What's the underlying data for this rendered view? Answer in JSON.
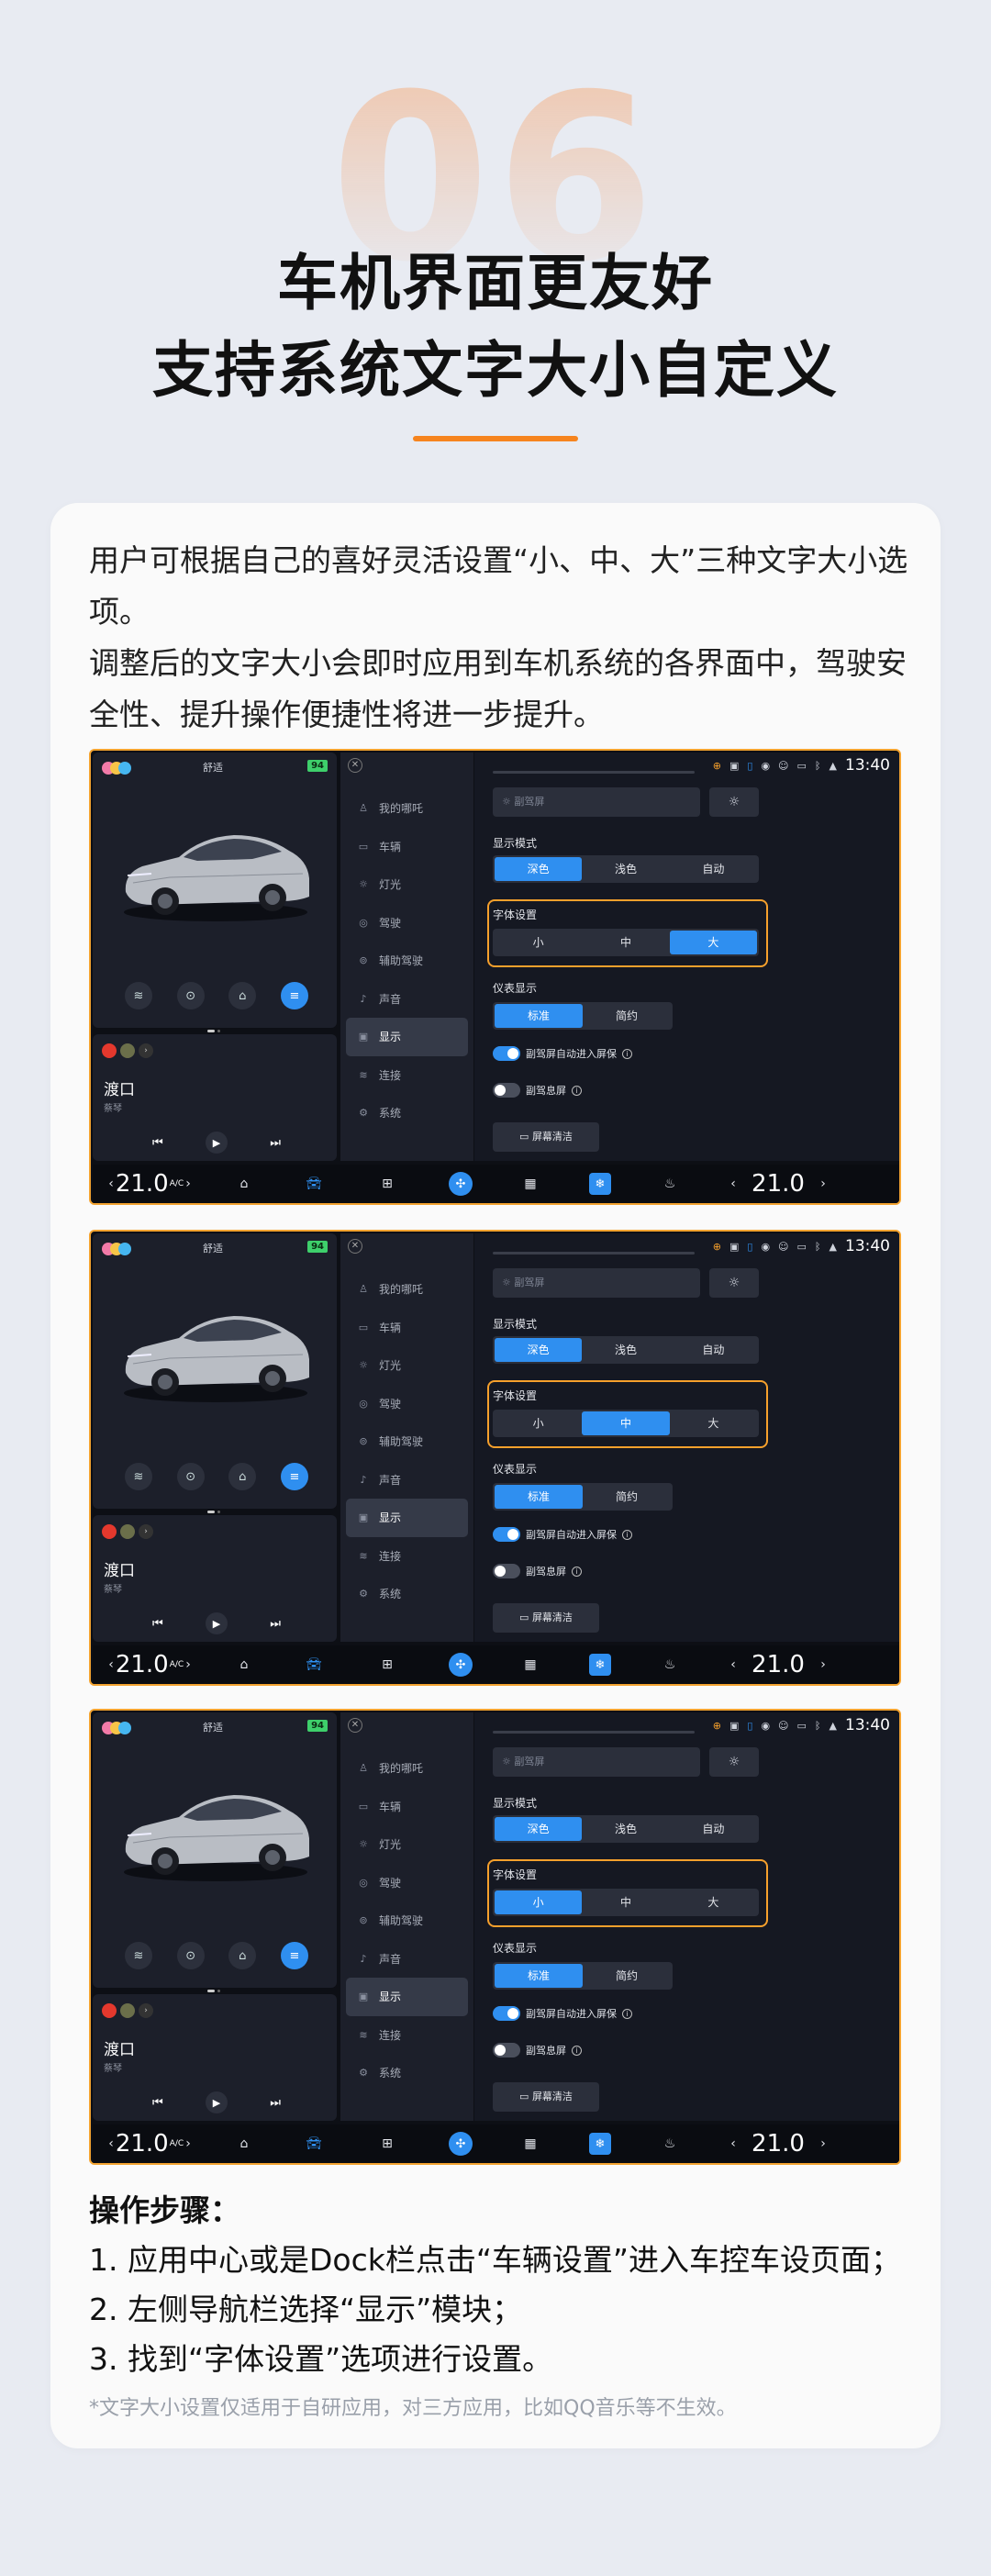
{
  "header": {
    "number": "06",
    "title_line1": "车机界面更友好",
    "title_line2": "支持系统文字大小自定义"
  },
  "description": {
    "para1": "用户可根据自己的喜好灵活设置“小、中、大”三种文字大小选项。",
    "para2": "调整后的文字大小会即时应用到车机系统的各界面中，驾驶安全性、提升操作便捷性将进一步提升。"
  },
  "ui": {
    "mode": "舒适",
    "battery": "94",
    "song": "渡口",
    "artist": "蔡琴",
    "nav_items": [
      "我的哪吒",
      "车辆",
      "灯光",
      "驾驶",
      "辅助驾驶",
      "声音",
      "显示",
      "连接",
      "系统"
    ],
    "nav_icons": [
      "person-icon",
      "car-icon",
      "light-icon",
      "steering-icon",
      "assist-icon",
      "sound-icon",
      "display-icon",
      "wifi-icon",
      "system-icon"
    ],
    "selected_nav": "显示",
    "time": "13:40",
    "sub_screen_placeholder": "副驾屏",
    "display_mode_label": "显示模式",
    "display_modes": [
      "深色",
      "浅色",
      "自动"
    ],
    "display_mode_selected": "深色",
    "font_label": "字体设置",
    "font_sizes": [
      "小",
      "中",
      "大"
    ],
    "meter_label": "仪表显示",
    "meter_options": [
      "标准",
      "简约"
    ],
    "meter_selected": "标准",
    "toggle1": "副驾屏自动进入屏保",
    "toggle2": "副驾息屏",
    "clean_btn": "屏幕清洁",
    "temp_left": "21.0",
    "temp_right": "21.0",
    "ac_label": "A/C"
  },
  "screens": [
    {
      "font_selected": "大"
    },
    {
      "font_selected": "中"
    },
    {
      "font_selected": "小"
    }
  ],
  "steps": {
    "heading": "操作步骤：",
    "items": [
      "1. 应用中心或是Dock栏点击“车辆设置”进入车控车设页面；",
      "2. 左侧导航栏选择“显示”模块；",
      "3. 找到“字体设置”选项进行设置。"
    ],
    "note": "*文字大小设置仅适用于自研应用，对三方应用，比如QQ音乐等不生效。"
  },
  "colors": {
    "accent": "#f6841f",
    "highlight_box": "#f6a02c",
    "selected_blue": "#2f8ff0",
    "screen_bg": "#0d0f15"
  }
}
